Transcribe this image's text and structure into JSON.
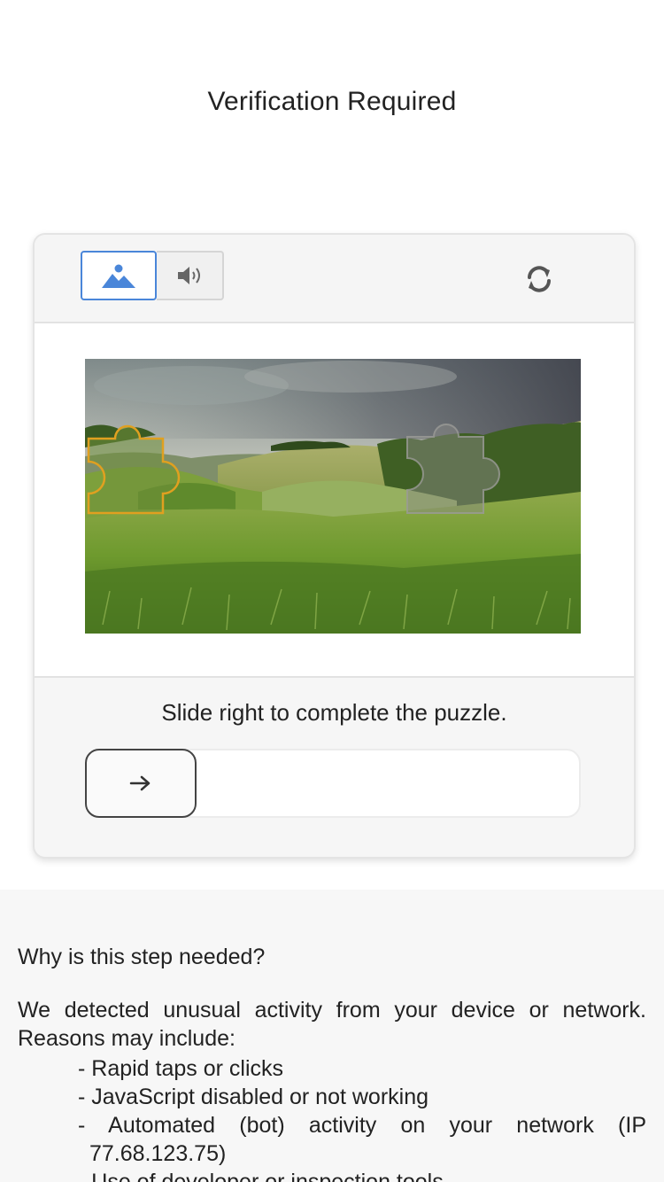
{
  "page": {
    "title": "Verification Required"
  },
  "captcha": {
    "modes": [
      {
        "name": "image",
        "icon": "image-icon",
        "selected": true
      },
      {
        "name": "audio",
        "icon": "speaker-icon",
        "selected": false
      }
    ],
    "refresh_icon": "refresh-icon",
    "instruction": "Slide right to complete the puzzle.",
    "slider": {
      "handle_icon": "arrow-right-icon",
      "progress": 0
    },
    "colors": {
      "selected_border": "#4a86d9",
      "piece_outline": "#e0a020"
    }
  },
  "info": {
    "question": "Why is this step needed?",
    "paragraph": "We detected unusual activity from your device or network. Reasons may include:",
    "reasons": [
      "- Rapid taps or clicks",
      "- JavaScript disabled or not working",
      "- Automated (bot) activity on your network (IP 77.68.123.75)",
      "- Use of developer or inspection tools"
    ]
  }
}
